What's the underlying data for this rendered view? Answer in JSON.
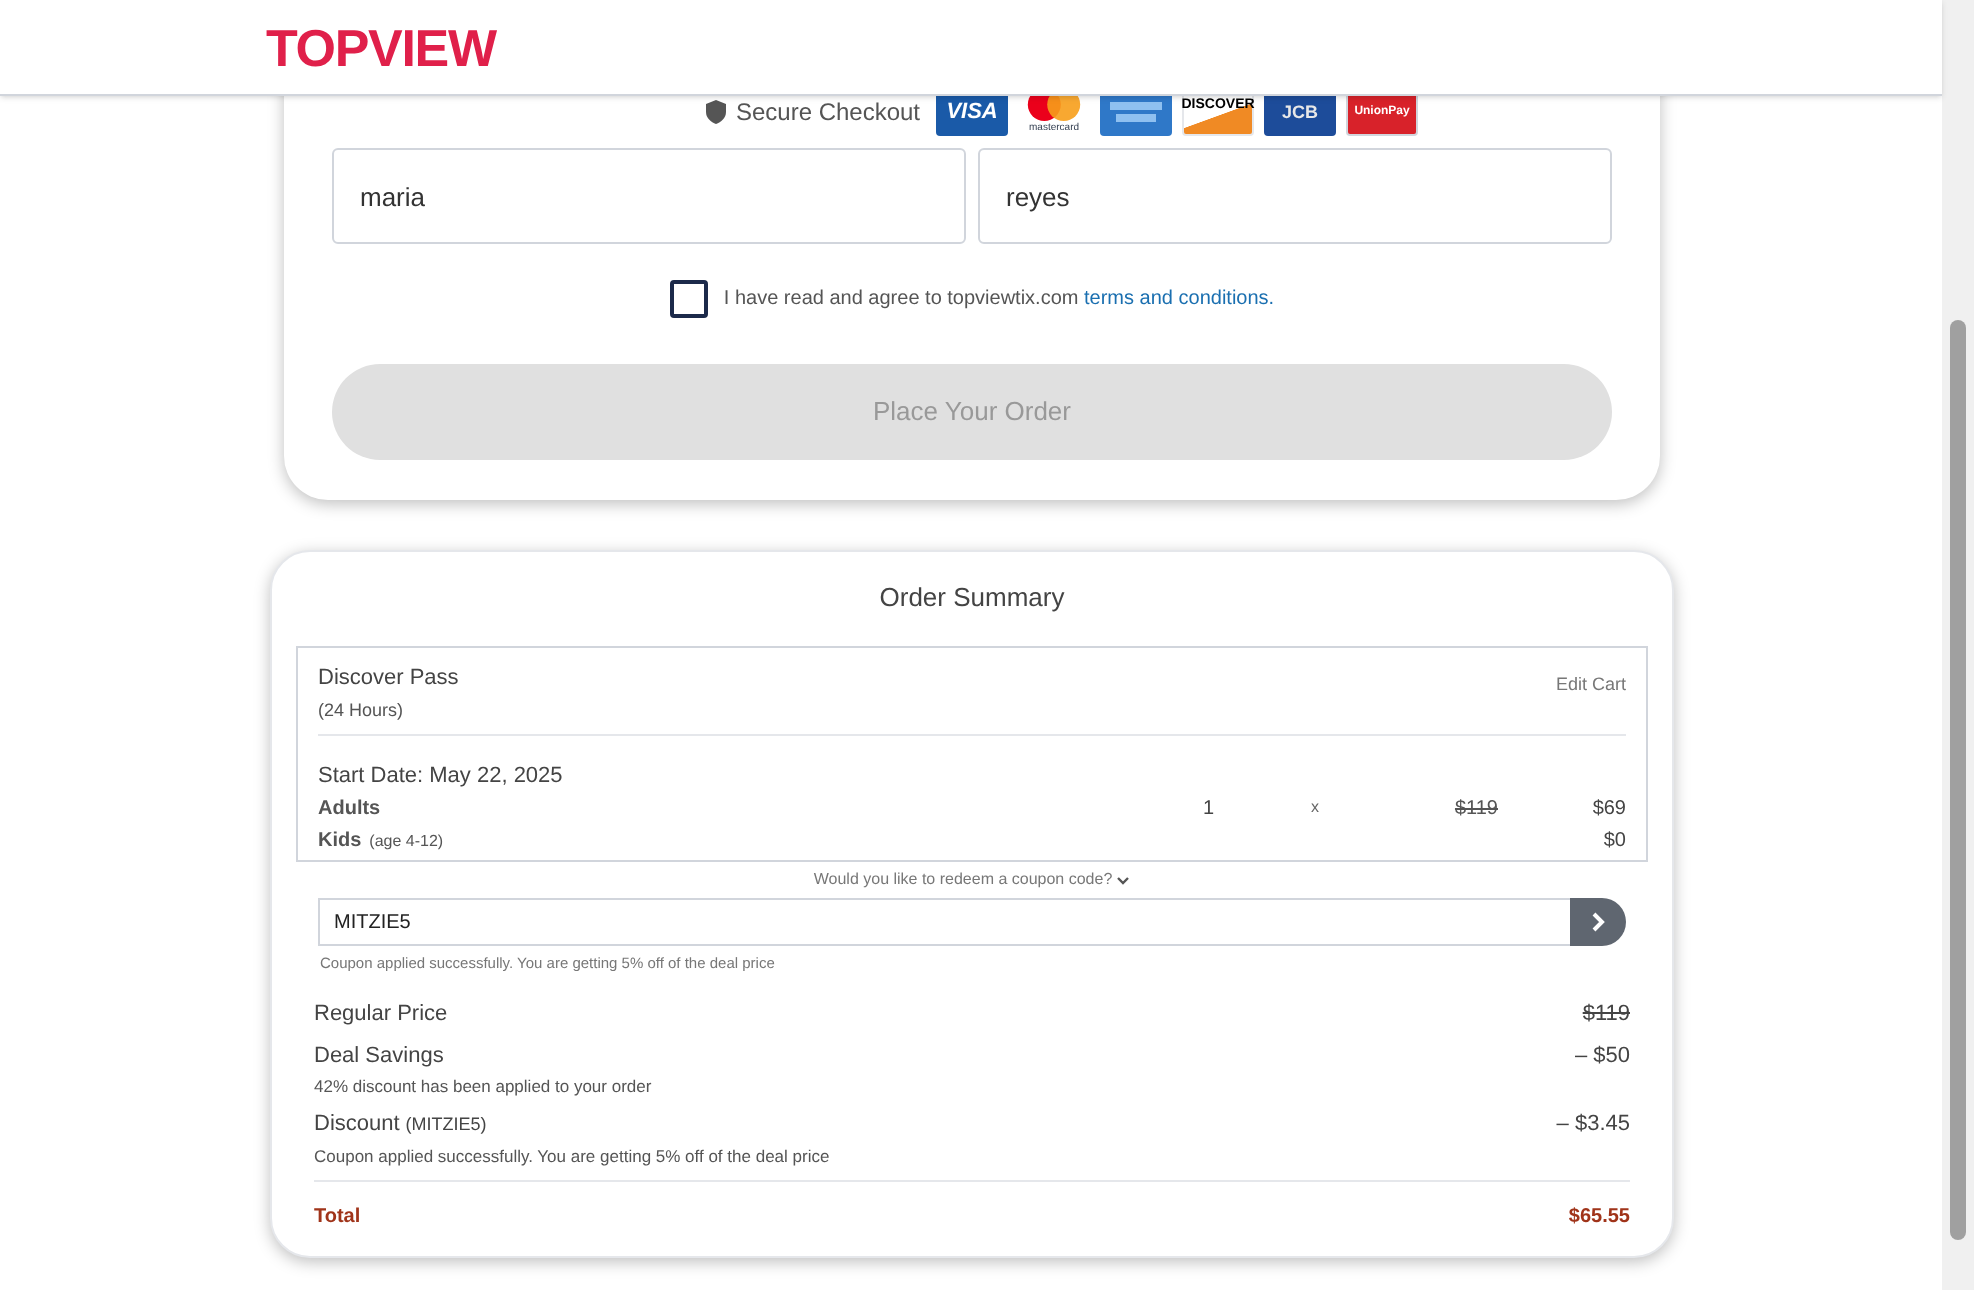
{
  "header": {
    "logo": "TOPVIEW"
  },
  "payment": {
    "secure_label": "Secure Checkout",
    "cards": [
      {
        "kind": "visa",
        "label": "VISA"
      },
      {
        "kind": "mastercard",
        "label": "mastercard"
      },
      {
        "kind": "amex"
      },
      {
        "kind": "discover",
        "label": "DISCOVER"
      },
      {
        "kind": "jcb",
        "label": "JCB"
      },
      {
        "kind": "unionpay",
        "label": "UnionPay"
      }
    ],
    "first_name": "maria",
    "last_name": "reyes",
    "agree": {
      "checked": false,
      "text": "I have read and agree to topviewtix.com",
      "link": "terms and conditions."
    },
    "submit": {
      "label": "Place Your Order",
      "disabled": true
    }
  },
  "summary": {
    "title": "Order Summary",
    "product": {
      "name": "Discover Pass",
      "duration": "(24 Hours)",
      "edit": "Edit Cart",
      "start_date": "Start Date: May 22, 2025",
      "lines": [
        {
          "label": "Adults",
          "qty": "1",
          "times": "x",
          "old_price": "$119",
          "price": "$69"
        },
        {
          "label": "Kids",
          "note": "(age 4-12)",
          "price": "$0"
        }
      ]
    },
    "coupon_prompt": "Would you like to redeem a coupon code?",
    "coupon_code": "MITZIE5",
    "coupon_message": "Coupon applied successfully. You are getting 5% off of the deal price",
    "rows": [
      {
        "label": "Regular Price",
        "value": "$119",
        "strike": true
      },
      {
        "label": "Deal Savings",
        "note": "42% discount has been applied to your order",
        "value": "– $50",
        "strike": false
      },
      {
        "label": "Discount",
        "code": "(MITZIE5)",
        "note": "Coupon applied successfully. You are getting 5% off of the deal price",
        "value": "– $3.45",
        "strike": false
      }
    ],
    "total": {
      "label": "Total",
      "value": "$65.55"
    }
  }
}
